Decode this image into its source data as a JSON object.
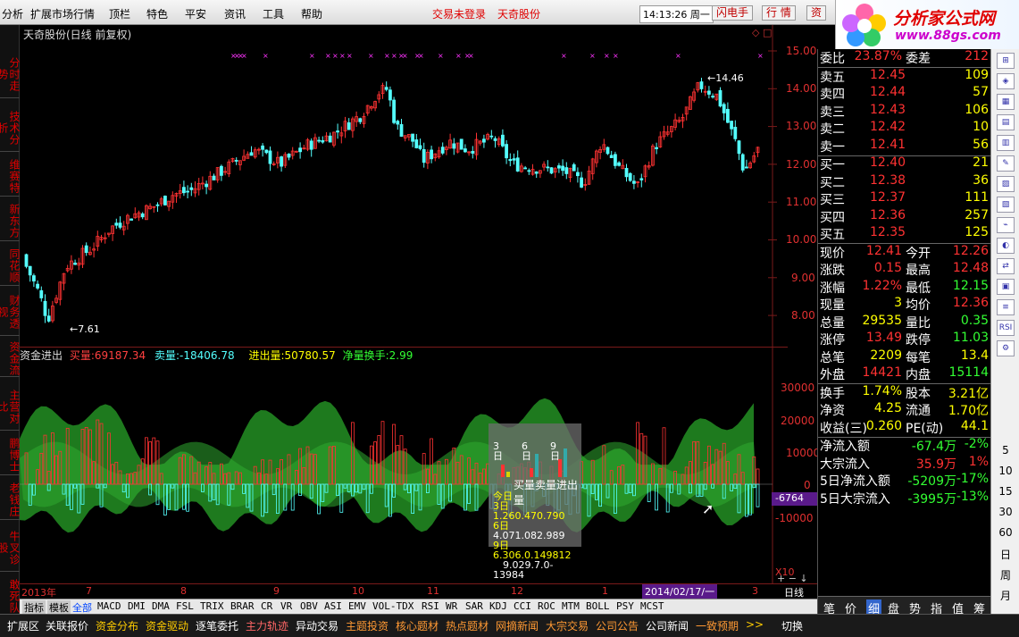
{
  "menubar": {
    "items": [
      "分析",
      "扩展市场行情",
      "顶栏",
      "特色",
      "平安",
      "资讯",
      "工具",
      "帮助"
    ],
    "login": "交易未登录",
    "stock": "天奇股份",
    "time": "14:13:26 周一",
    "btns": [
      "闪电手",
      "行 情",
      "资"
    ]
  },
  "logo": {
    "name": "分析家公式网",
    "url": "www.88gs.com"
  },
  "lefttabs": [
    "分时走势",
    "技术分析",
    "维赛特",
    "新东方",
    "同花顺",
    "财务透视",
    "资金流",
    "主营对比",
    "鹏博士",
    "老钱庄",
    "牛叉诊股",
    "敢死队"
  ],
  "chart": {
    "title": "天奇股份(日线 前复权)",
    "price_axis": [
      "15.00",
      "14.00",
      "13.00",
      "12.00",
      "11.00",
      "10.00",
      "9.00",
      "8.00"
    ],
    "high_label": "14.46",
    "low_label": "7.61",
    "flow_axis": [
      "30000",
      "20000",
      "10000",
      "0",
      "-10000"
    ],
    "flow_now": "-6764",
    "x10": "X10",
    "dates": [
      "2013年",
      "7",
      "8",
      "9",
      "10",
      "11",
      "12",
      "1",
      "2014/02/17/一",
      "3"
    ],
    "period": "日线",
    "indicator": {
      "name": "资金进出",
      "buy_label": "买量:",
      "buy": "69187.34",
      "sell_label": "卖量:",
      "sell": "-18406.78",
      "net_label": "进出量:",
      "net": "50780.57",
      "turn_label": "净量换手:",
      "turn": "2.99"
    }
  },
  "popup": {
    "title": "买量卖量进出量",
    "heads": [
      "3",
      "日",
      "6",
      "日",
      "9",
      "日"
    ],
    "rows": [
      {
        "k": "今日",
        "v": ""
      },
      {
        "k": "3日",
        "v": "1.260.470.790"
      },
      {
        "k": "6日",
        "v": "4.071.082.989"
      },
      {
        "k": "9日",
        "v": "6.306.0.149812"
      },
      {
        "k": "",
        "v": "9.029.7.0-13984"
      }
    ]
  },
  "quote": {
    "webi_label": "委比",
    "webi": "23.87%",
    "weic_label": "委差",
    "weic": "212",
    "asks": [
      {
        "l": "卖五",
        "p": "12.45",
        "v": "109"
      },
      {
        "l": "卖四",
        "p": "12.44",
        "v": "57"
      },
      {
        "l": "卖三",
        "p": "12.43",
        "v": "106"
      },
      {
        "l": "卖二",
        "p": "12.42",
        "v": "10"
      },
      {
        "l": "卖一",
        "p": "12.41",
        "v": "56"
      }
    ],
    "bids": [
      {
        "l": "买一",
        "p": "12.40",
        "v": "21"
      },
      {
        "l": "买二",
        "p": "12.38",
        "v": "36"
      },
      {
        "l": "买三",
        "p": "12.37",
        "v": "111"
      },
      {
        "l": "买四",
        "p": "12.36",
        "v": "257"
      },
      {
        "l": "买五",
        "p": "12.35",
        "v": "125"
      }
    ],
    "stats": [
      {
        "a": "现价",
        "av": "12.41",
        "b": "今开",
        "bv": "12.26"
      },
      {
        "a": "涨跌",
        "av": "0.15",
        "b": "最高",
        "bv": "12.48"
      },
      {
        "a": "涨幅",
        "av": "1.22%",
        "b": "最低",
        "bv": "12.15"
      },
      {
        "a": "现量",
        "av": "3",
        "b": "均价",
        "bv": "12.36"
      },
      {
        "a": "总量",
        "av": "29535",
        "b": "量比",
        "bv": "0.35"
      },
      {
        "a": "涨停",
        "av": "13.49",
        "b": "跌停",
        "bv": "11.03"
      },
      {
        "a": "总笔",
        "av": "2209",
        "b": "每笔",
        "bv": "13.4"
      },
      {
        "a": "外盘",
        "av": "14421",
        "b": "内盘",
        "bv": "15114"
      }
    ],
    "fin": [
      {
        "a": "换手",
        "av": "1.74%",
        "b": "股本",
        "bv": "3.21亿"
      },
      {
        "a": "净资",
        "av": "4.25",
        "b": "流通",
        "bv": "1.70亿"
      },
      {
        "a": "收益(三)",
        "av": "0.260",
        "b": "PE(动)",
        "bv": "44.1"
      }
    ],
    "flows": [
      {
        "a": "净流入额",
        "v": "-67.4万",
        "p": "-2%"
      },
      {
        "a": "大宗流入",
        "v": "35.9万",
        "p": "1%"
      },
      {
        "a": "5日净流入额",
        "v": "-5209万",
        "p": "-17%"
      },
      {
        "a": "5日大宗流入",
        "v": "-3995万",
        "p": "-13%"
      }
    ],
    "tabs": [
      "笔",
      "价",
      "细",
      "盘",
      "势",
      "指",
      "值",
      "筹"
    ]
  },
  "icons_nums": [
    "5",
    "10",
    "15",
    "30",
    "60",
    "日",
    "周",
    "月"
  ],
  "indbar": [
    "指标",
    "模板",
    "全部",
    "MACD",
    "DMI",
    "DMA",
    "FSL",
    "TRIX",
    "BRAR",
    "CR",
    "VR",
    "OBV",
    "ASI",
    "EMV",
    "VOL-TDX",
    "RSI",
    "WR",
    "SAR",
    "KDJ",
    "CCI",
    "ROC",
    "MTM",
    "BOLL",
    "PSY",
    "MCST"
  ],
  "bottombar": [
    "扩展区",
    "关联报价",
    "资金分布",
    "资金驱动",
    "逐笔委托",
    "主力轨迹",
    "异动交易",
    "主题投资",
    "核心题材",
    "热点题材",
    "网摘新闻",
    "大宗交易",
    "公司公告",
    "公司新闻",
    "一致预期",
    ">>"
  ],
  "right_bottom": [
    "切",
    "换"
  ],
  "colors": {
    "up": "#ff3232",
    "down": "#54ffff",
    "green_band": "#1e8c1e",
    "accent": "#e00000"
  }
}
